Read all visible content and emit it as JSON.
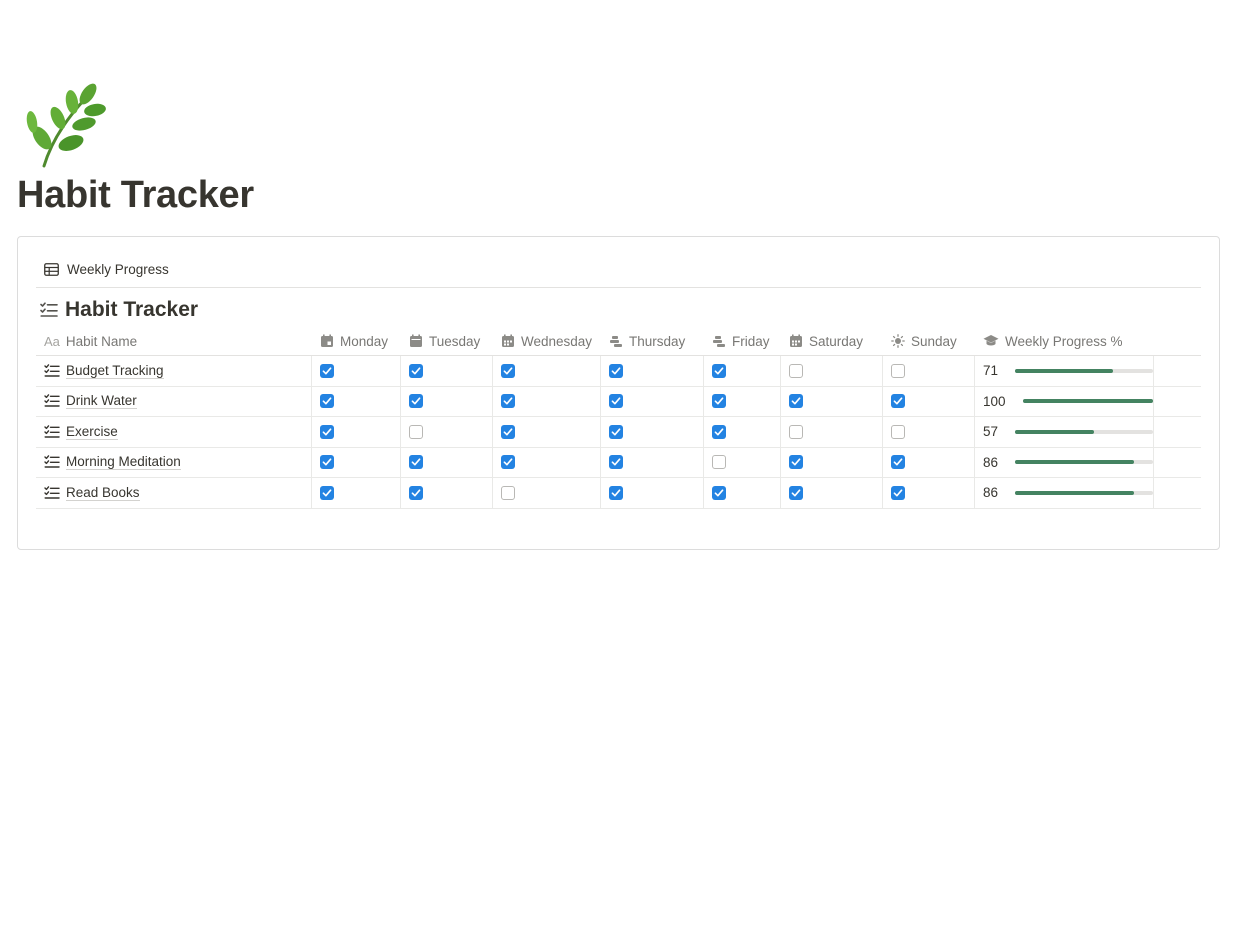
{
  "page": {
    "icon": "herb-icon",
    "title": "Habit Tracker"
  },
  "view_tab": {
    "icon": "table-icon",
    "label": "Weekly Progress"
  },
  "database": {
    "icon": "checklist-icon",
    "title": "Habit Tracker",
    "columns": {
      "name": "Habit Name",
      "name_icon_text": "Aa",
      "monday": "Monday",
      "tuesday": "Tuesday",
      "wednesday": "Wednesday",
      "thursday": "Thursday",
      "friday": "Friday",
      "saturday": "Saturday",
      "sunday": "Sunday",
      "progress": "Weekly Progress %"
    },
    "rows": [
      {
        "name": "Budget Tracking",
        "days": [
          true,
          true,
          true,
          true,
          true,
          false,
          false
        ],
        "progress": "71",
        "progress_value": 71
      },
      {
        "name": "Drink Water",
        "days": [
          true,
          true,
          true,
          true,
          true,
          true,
          true
        ],
        "progress": "100",
        "progress_value": 100
      },
      {
        "name": "Exercise",
        "days": [
          true,
          false,
          true,
          true,
          true,
          false,
          false
        ],
        "progress": "57",
        "progress_value": 57
      },
      {
        "name": "Morning Meditation",
        "days": [
          true,
          true,
          true,
          true,
          false,
          true,
          true
        ],
        "progress": "86",
        "progress_value": 86
      },
      {
        "name": "Read Books",
        "days": [
          true,
          true,
          false,
          true,
          true,
          true,
          true
        ],
        "progress": "86",
        "progress_value": 86
      }
    ]
  },
  "colors": {
    "checkbox_checked": "#2383e2",
    "progress_fill": "#448361",
    "progress_track": "#e3e2e0"
  }
}
